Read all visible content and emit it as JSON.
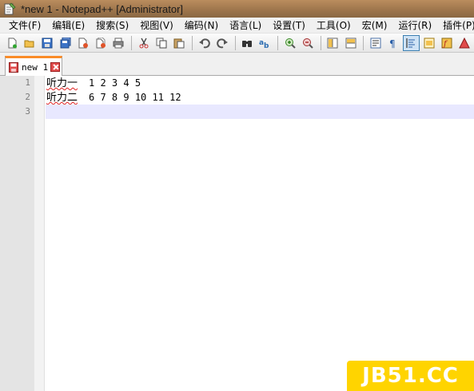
{
  "window": {
    "title": "*new 1 - Notepad++ [Administrator]"
  },
  "menu": [
    "文件(F)",
    "编辑(E)",
    "搜索(S)",
    "视图(V)",
    "编码(N)",
    "语言(L)",
    "设置(T)",
    "工具(O)",
    "宏(M)",
    "运行(R)",
    "插件(P)"
  ],
  "toolbar_icons": [
    "new-file-icon",
    "open-file-icon",
    "save-icon",
    "save-all-icon",
    "close-file-icon",
    "close-all-icon",
    "print-icon",
    "cut-icon",
    "copy-icon",
    "paste-icon",
    "undo-icon",
    "redo-icon",
    "find-icon",
    "replace-icon",
    "zoom-in-icon",
    "zoom-out-icon",
    "sync-vertical-icon",
    "sync-horizontal-icon",
    "word-wrap-icon",
    "show-all-chars-icon",
    "indent-guide-icon",
    "doc-map-icon",
    "function-list-icon",
    "macro-record-icon"
  ],
  "tab": {
    "label": "new 1"
  },
  "lines": [
    {
      "number": "1",
      "cjk": "听力一",
      "rest": "1 2 3 4 5"
    },
    {
      "number": "2",
      "cjk": "听力二",
      "rest": "6 7 8 9 10 11 12"
    },
    {
      "number": "3",
      "cjk": "",
      "rest": ""
    }
  ],
  "watermark": {
    "text": "JB51.CC"
  },
  "colors": {
    "tab_accent": "#fa8c28",
    "current_line": "#e8e8ff",
    "watermark_bg": "#ffd400"
  }
}
